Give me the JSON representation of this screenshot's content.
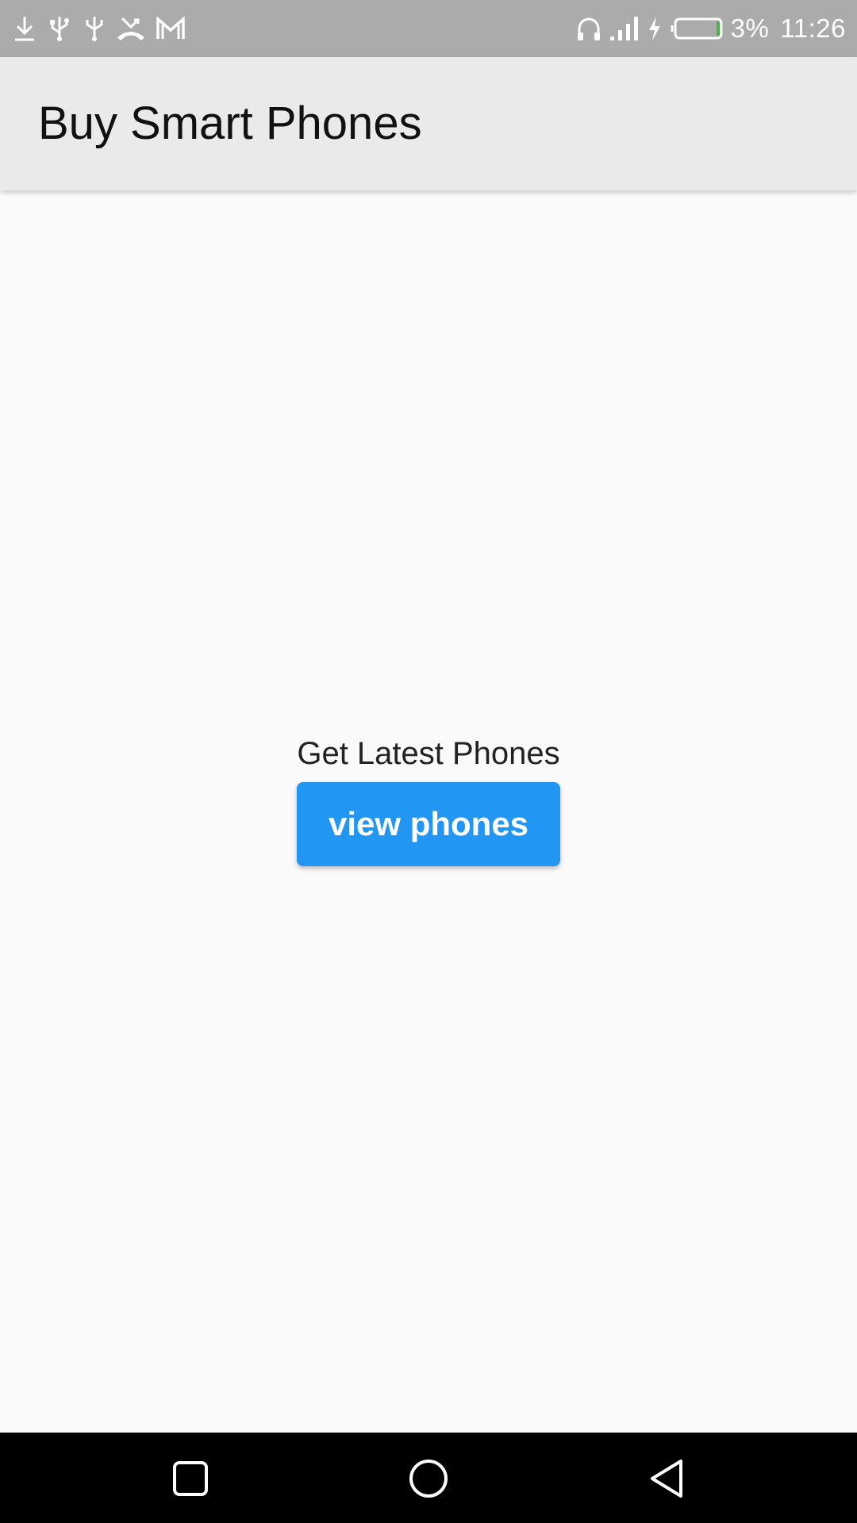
{
  "status_bar": {
    "left_icons": [
      "download-icon",
      "usb-icon",
      "usb-icon",
      "missed-call-icon",
      "gmail-icon"
    ],
    "right_icons": [
      "headphones-icon",
      "signal-icon",
      "charging-icon",
      "battery-icon"
    ],
    "battery_percent_text": "3%",
    "battery_level": 0.03,
    "time": "11:26"
  },
  "app_bar": {
    "title": "Buy Smart Phones"
  },
  "main": {
    "subtitle": "Get Latest Phones",
    "button_label": "view phones"
  },
  "nav_bar": {
    "buttons": [
      "recents-icon",
      "home-icon",
      "back-icon"
    ]
  },
  "colors": {
    "status_bar": "#ababab",
    "app_bar": "#eaeaea",
    "background": "#fafafa",
    "accent": "#2196f3",
    "battery_fill": "#4caf50"
  }
}
